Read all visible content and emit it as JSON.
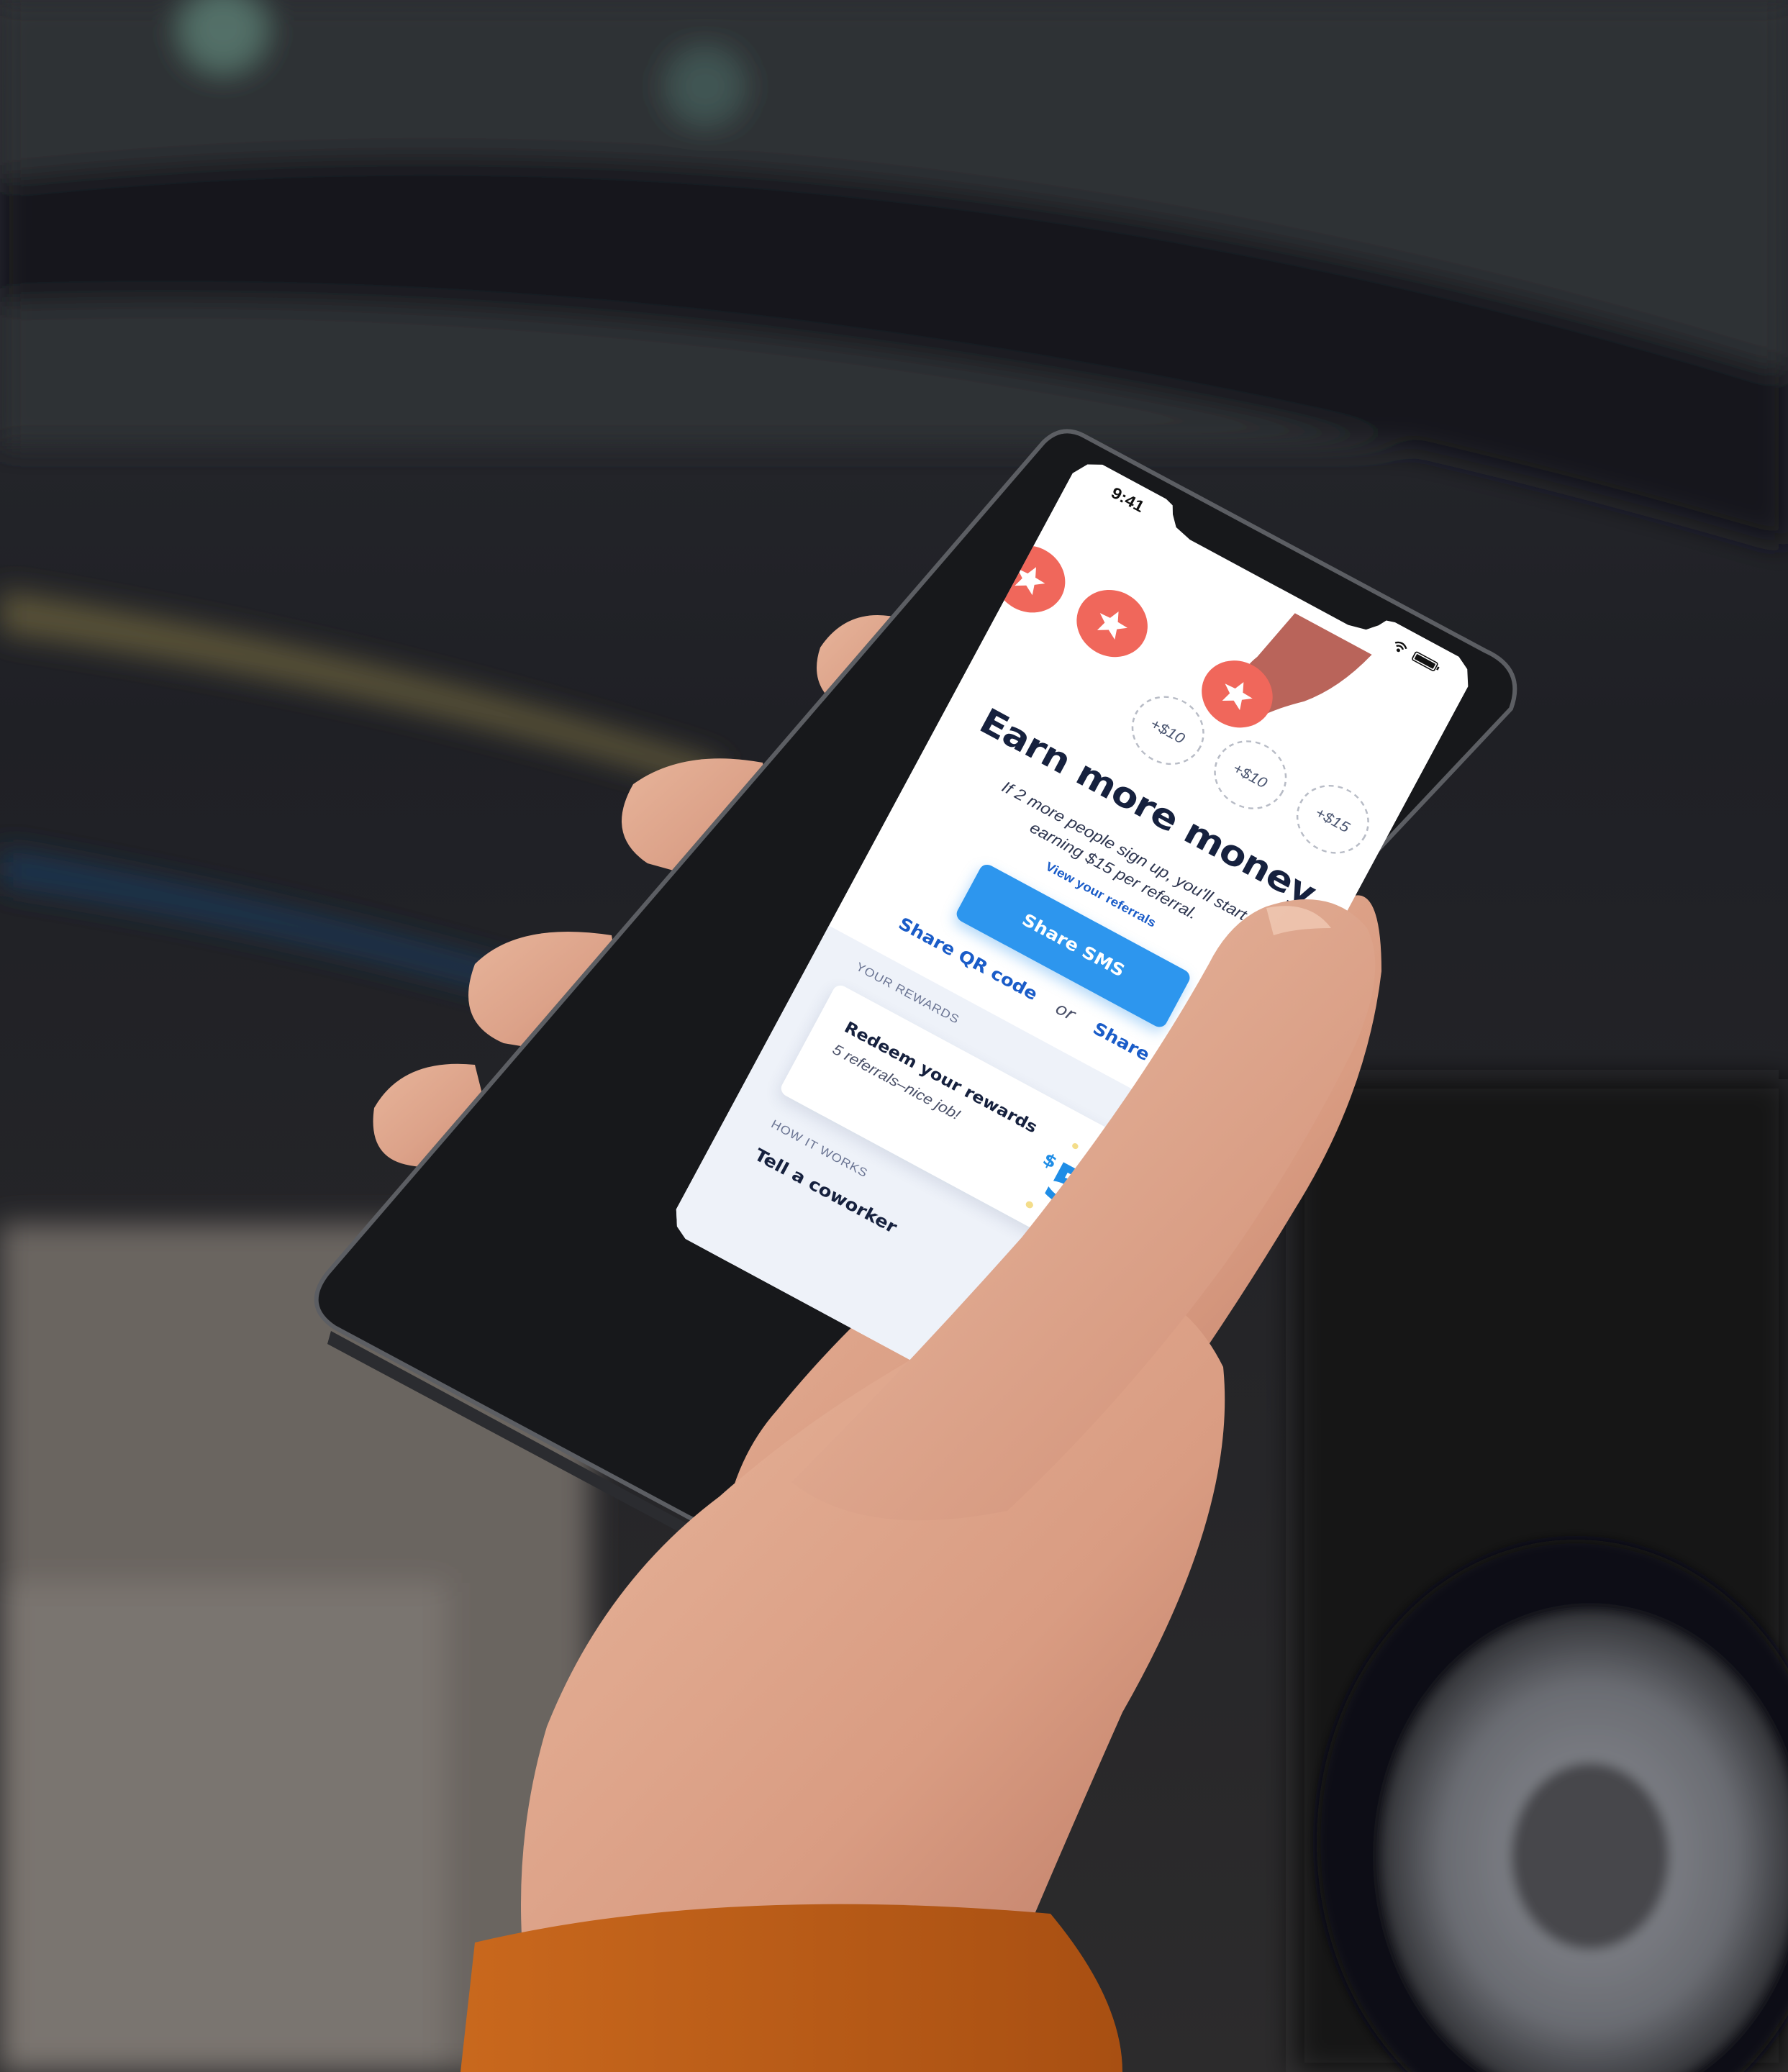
{
  "status_bar": {
    "time": "9:41"
  },
  "hero": {
    "star_icons": [
      "star-icon",
      "star-icon",
      "star-icon"
    ],
    "bonus_slots": [
      "+$10",
      "+$10",
      "+$15"
    ],
    "accent_color": "#f0675b"
  },
  "main": {
    "headline": "Earn more money",
    "subtext": "If 2 more people sign up, you'll start earning $15 per referral.",
    "view_referrals_link": "View your referrals",
    "share_sms_button": "Share SMS",
    "share_qr_link": "Share QR code",
    "or_label": "or",
    "share_link": "Share link"
  },
  "rewards": {
    "section_label": "YOUR REWARDS",
    "card_title": "Redeem your rewards",
    "card_subtitle": "5 referrals–nice job!",
    "amount_currency": "$",
    "amount_value": "50"
  },
  "how_it_works": {
    "section_label": "HOW IT WORKS",
    "first_step": "Tell a coworker"
  },
  "colors": {
    "brand_blue": "#2d96ee",
    "link_blue": "#1a5cc8",
    "navy_text": "#16213e",
    "coin_red": "#f0675b",
    "rewards_bg": "#eef2f9"
  }
}
